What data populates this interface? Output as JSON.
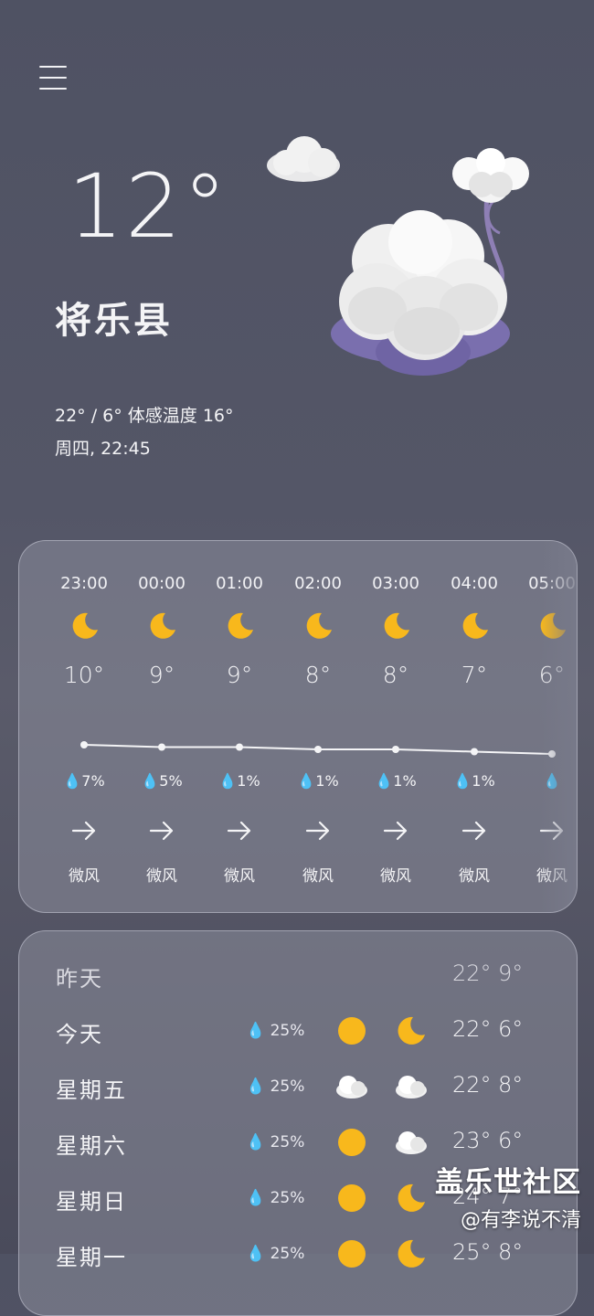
{
  "header": {
    "temperature": "12°",
    "city": "将乐县",
    "range_feels": "22° / 6° 体感温度 16°",
    "datetime": "周四, 22:45"
  },
  "hourly": [
    {
      "time": "23:00",
      "icon": "moon-icon",
      "temp": "10°",
      "precip": "7%",
      "wind": "微风",
      "temp_value": 10
    },
    {
      "time": "00:00",
      "icon": "moon-icon",
      "temp": "9°",
      "precip": "5%",
      "wind": "微风",
      "temp_value": 9
    },
    {
      "time": "01:00",
      "icon": "moon-icon",
      "temp": "9°",
      "precip": "1%",
      "wind": "微风",
      "temp_value": 9
    },
    {
      "time": "02:00",
      "icon": "moon-icon",
      "temp": "8°",
      "precip": "1%",
      "wind": "微风",
      "temp_value": 8
    },
    {
      "time": "03:00",
      "icon": "moon-icon",
      "temp": "8°",
      "precip": "1%",
      "wind": "微风",
      "temp_value": 8
    },
    {
      "time": "04:00",
      "icon": "moon-icon",
      "temp": "7°",
      "precip": "1%",
      "wind": "微风",
      "temp_value": 7
    },
    {
      "time": "05:00",
      "icon": "moon-icon",
      "temp": "6°",
      "precip": "",
      "wind": "微风",
      "temp_value": 6
    }
  ],
  "daily": [
    {
      "day": "昨天",
      "precip": "",
      "icon_day": "",
      "icon_night": "",
      "hi": "22°",
      "lo": "9°"
    },
    {
      "day": "今天",
      "precip": "25%",
      "icon_day": "sun-icon",
      "icon_night": "moon-icon",
      "hi": "22°",
      "lo": "6°"
    },
    {
      "day": "星期五",
      "precip": "25%",
      "icon_day": "cloud-icon",
      "icon_night": "cloud-icon",
      "hi": "22°",
      "lo": "8°"
    },
    {
      "day": "星期六",
      "precip": "25%",
      "icon_day": "sun-icon",
      "icon_night": "cloud-icon",
      "hi": "23°",
      "lo": "6°"
    },
    {
      "day": "星期日",
      "precip": "25%",
      "icon_day": "sun-icon",
      "icon_night": "moon-icon",
      "hi": "24°",
      "lo": "7°"
    },
    {
      "day": "星期一",
      "precip": "25%",
      "icon_day": "sun-icon",
      "icon_night": "moon-icon",
      "hi": "25°",
      "lo": "8°"
    }
  ],
  "watermark": {
    "line1": "盖乐世社区",
    "line2": "@有李说不清"
  },
  "colors": {
    "sun": "#f8b81c",
    "moon": "#f8b81c",
    "cloud": "#f2f2f2",
    "cotton_shadow": "#7e73b0"
  }
}
